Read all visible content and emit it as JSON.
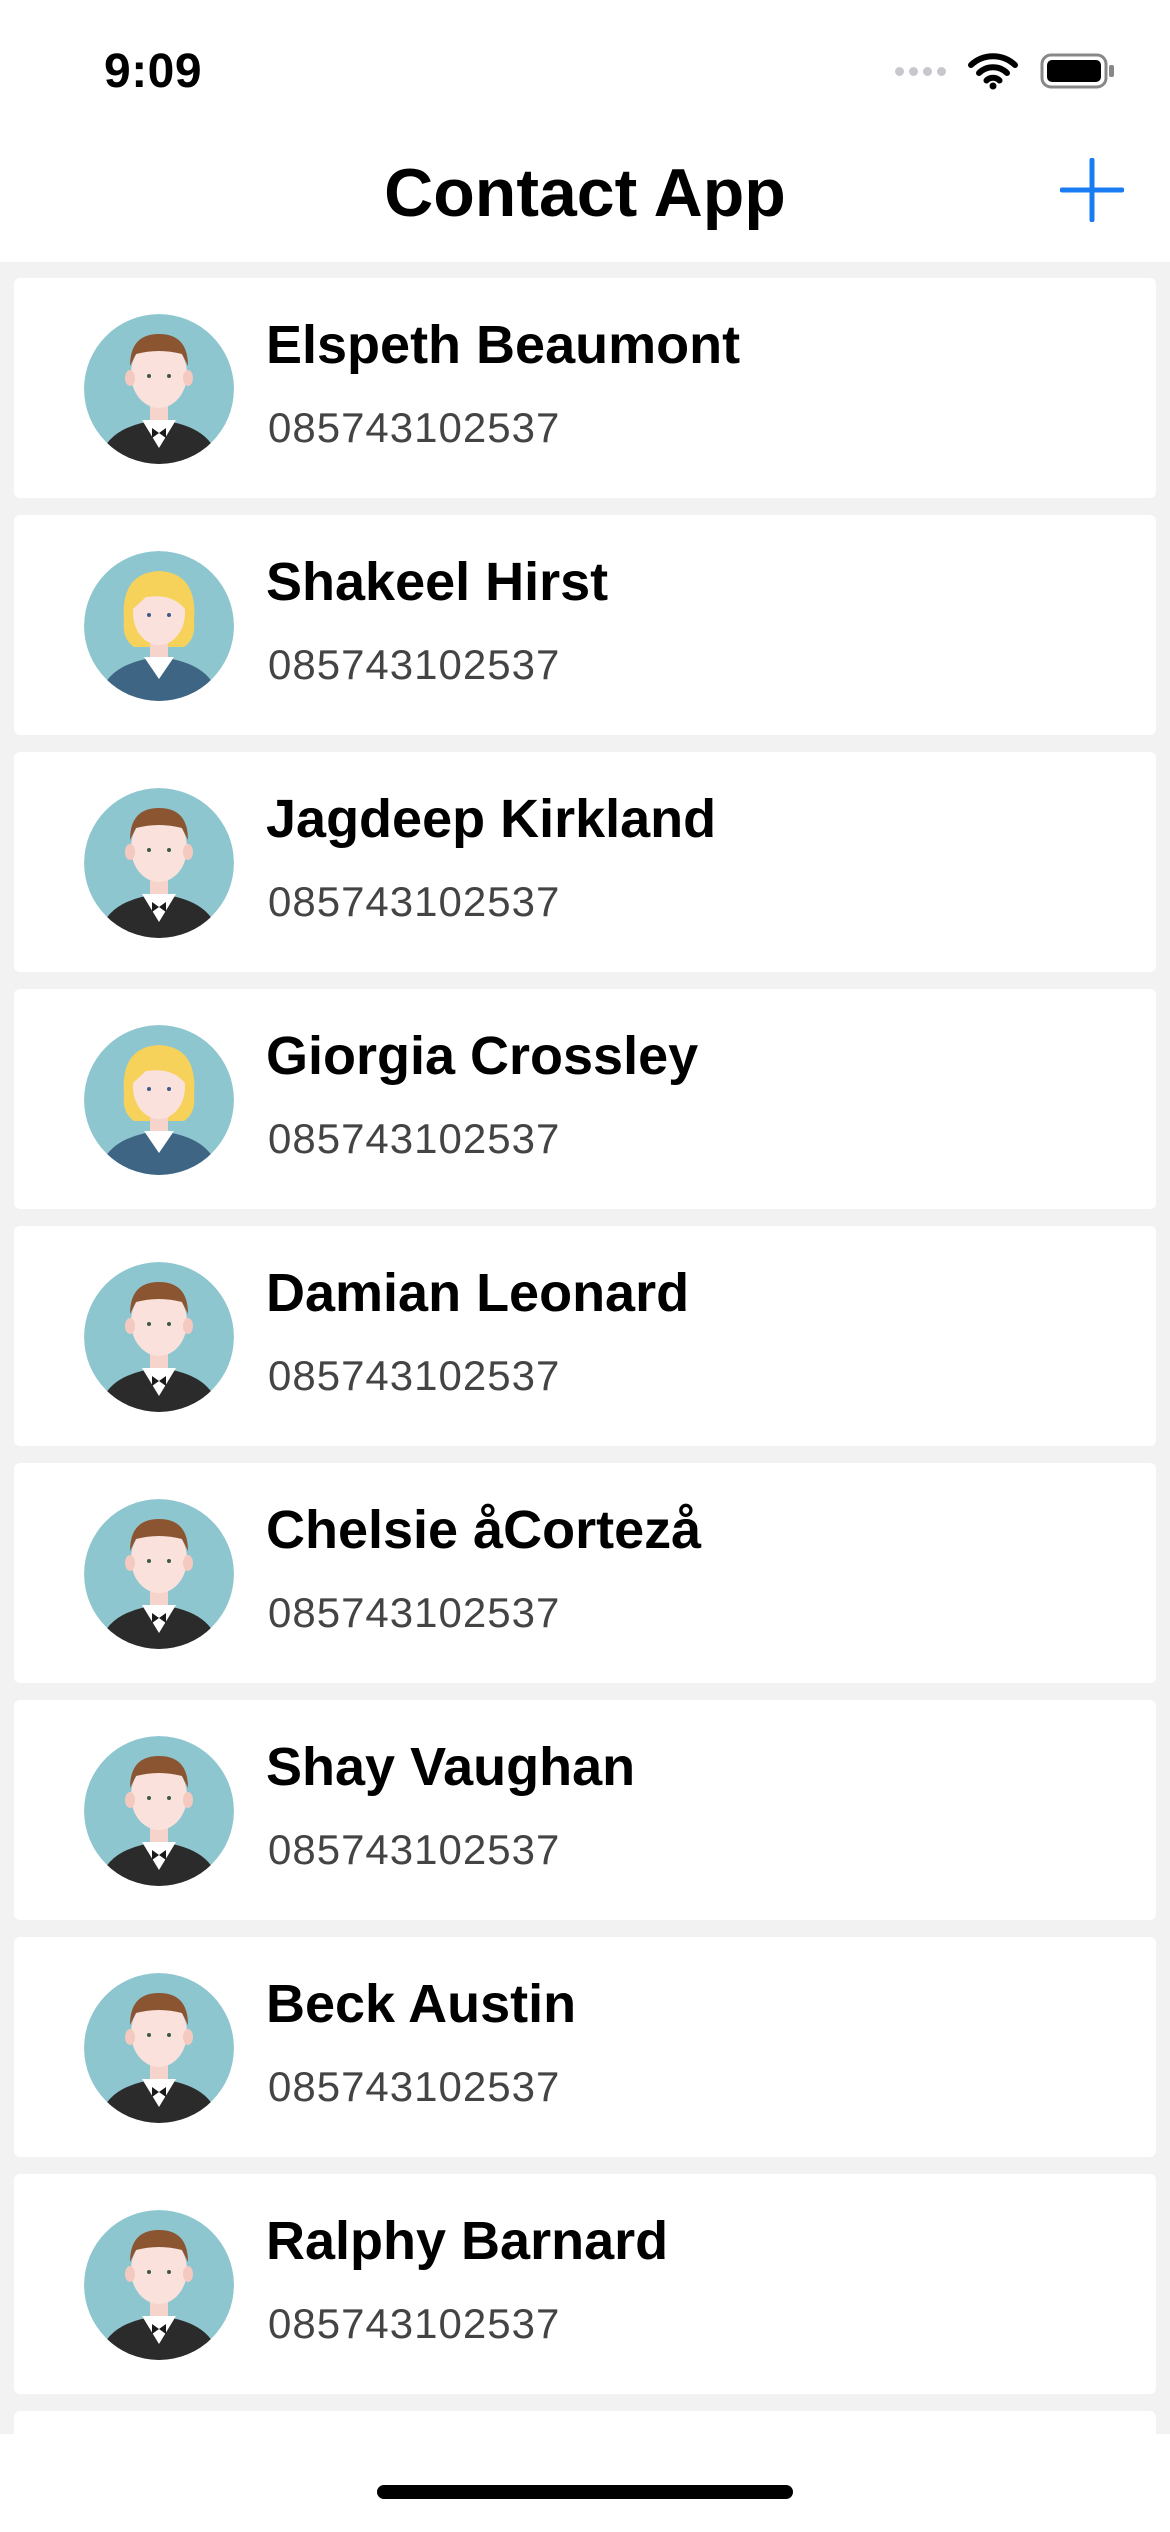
{
  "status_bar": {
    "time": "9:09",
    "icons": [
      "signal-dots-icon",
      "wifi-icon",
      "battery-icon"
    ]
  },
  "nav": {
    "title": "Contact App",
    "add_icon": "plus-icon",
    "accent_color": "#1a7cf2"
  },
  "contacts": [
    {
      "name": "Elspeth Beaumont",
      "phone": "085743102537",
      "avatar": "male-avatar-icon"
    },
    {
      "name": "Shakeel Hirst",
      "phone": "085743102537",
      "avatar": "female-avatar-icon"
    },
    {
      "name": "Jagdeep Kirkland",
      "phone": "085743102537",
      "avatar": "male-avatar-icon"
    },
    {
      "name": "Giorgia Crossley",
      "phone": "085743102537",
      "avatar": "female-avatar-icon"
    },
    {
      "name": "Damian Leonard",
      "phone": "085743102537",
      "avatar": "male-avatar-icon"
    },
    {
      "name": "Chelsie åCortezå",
      "phone": "085743102537",
      "avatar": "male-avatar-icon"
    },
    {
      "name": "Shay Vaughan",
      "phone": "085743102537",
      "avatar": "male-avatar-icon"
    },
    {
      "name": "Beck Austin",
      "phone": "085743102537",
      "avatar": "male-avatar-icon"
    },
    {
      "name": "Ralphy Barnard",
      "phone": "085743102537",
      "avatar": "male-avatar-icon"
    }
  ]
}
